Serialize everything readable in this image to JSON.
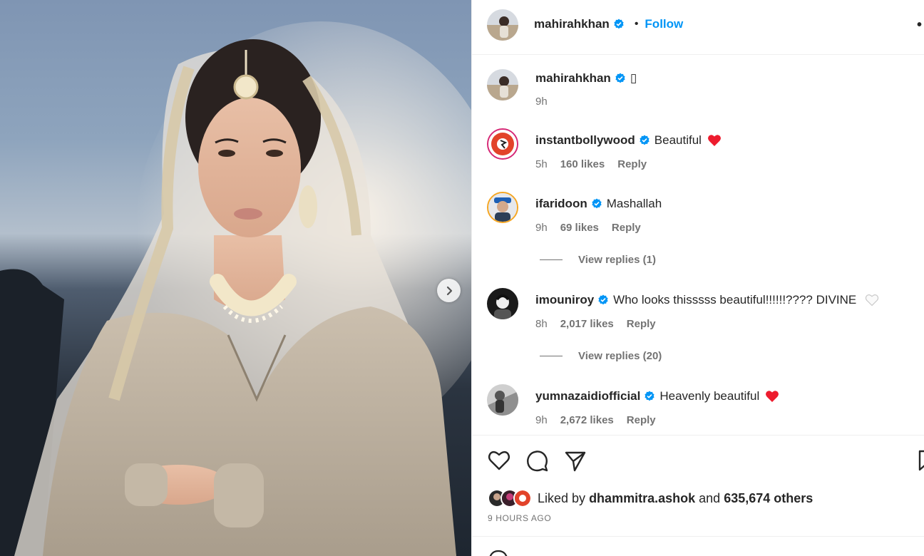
{
  "post": {
    "username": "mahirahkhan",
    "follow_label": "Follow",
    "separator": "•",
    "more_label": "•",
    "caption_glyph": "▯",
    "caption_time": "9h"
  },
  "comments": [
    {
      "username": "instantbollywood",
      "text": "Beautiful",
      "time": "5h",
      "likes": "160 likes",
      "reply": "Reply",
      "reaction": "red-heart"
    },
    {
      "username": "ifaridoon",
      "text": "Mashallah",
      "time": "9h",
      "likes": "69 likes",
      "reply": "Reply",
      "view_replies": "View replies (1)"
    },
    {
      "username": "imouniroy",
      "text": "Who looks thisssss beautiful!!!!!!???? DIVINE",
      "time": "8h",
      "likes": "2,017 likes",
      "reply": "Reply",
      "view_replies": "View replies (20)",
      "reaction": "white-heart"
    },
    {
      "username": "yumnazaidiofficial",
      "text": "Heavenly beautiful",
      "time": "9h",
      "likes": "2,672 likes",
      "reply": "Reply",
      "reaction": "red-heart"
    }
  ],
  "liked_by": {
    "prefix": "Liked by",
    "user": "dhammitra.ashok",
    "conj": "and",
    "others": "635,674 others"
  },
  "time_ago": "9 HOURS AGO",
  "colors": {
    "accent": "#0095f6",
    "verified": "#0095f6",
    "heart": "#ed1c2e",
    "muted": "#737373"
  },
  "icons": [
    "next-arrow-icon",
    "verified-icon",
    "like-icon",
    "comment-icon",
    "share-icon",
    "save-icon",
    "more-icon"
  ]
}
